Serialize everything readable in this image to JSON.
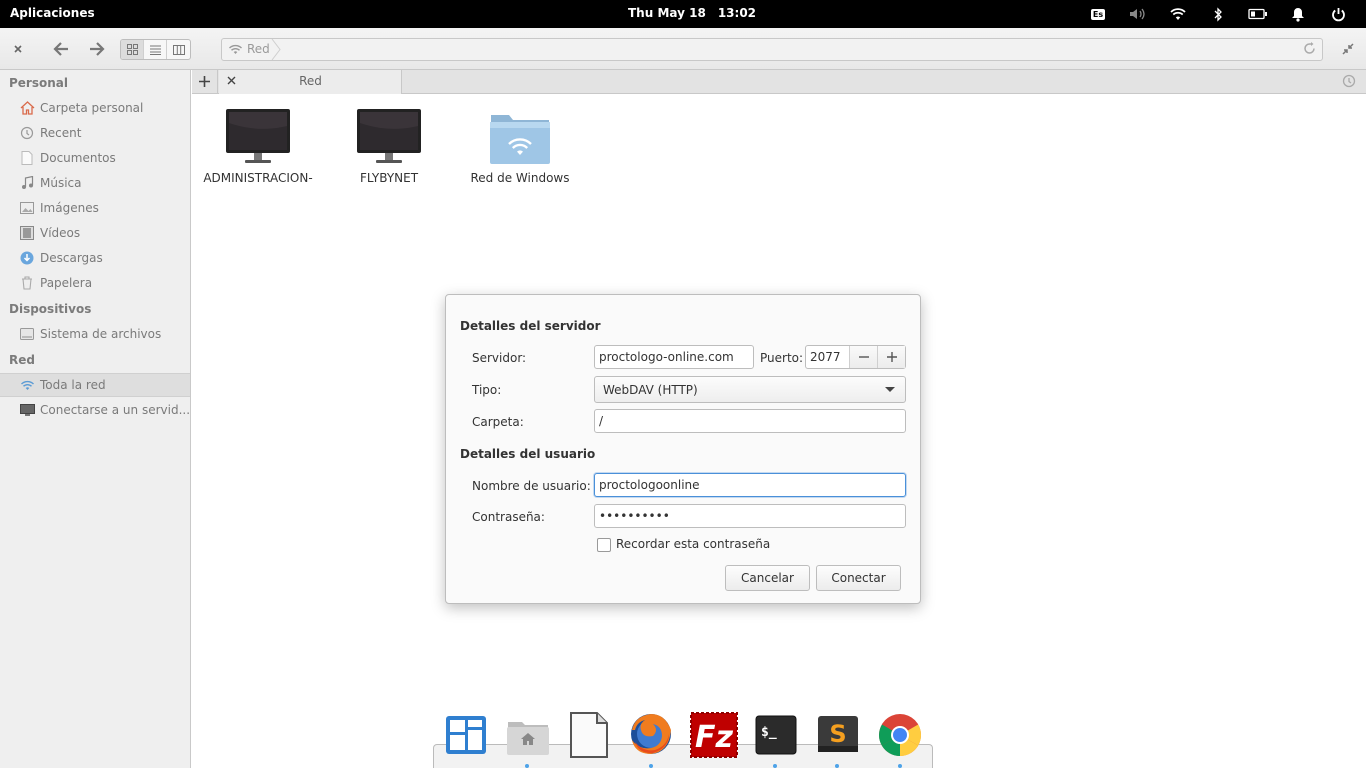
{
  "top_panel": {
    "apps_label": "Aplicaciones",
    "day_date": "Thu May 18",
    "time": "13:02",
    "keyboard_layout": "Es"
  },
  "headerbar": {
    "location": "Red"
  },
  "sidebar": {
    "sections": [
      {
        "heading": "Personal",
        "items": [
          {
            "label": "Carpeta personal",
            "icon": "home-icon"
          },
          {
            "label": "Recent",
            "icon": "recent-icon"
          },
          {
            "label": "Documentos",
            "icon": "document-icon"
          },
          {
            "label": "Música",
            "icon": "music-icon"
          },
          {
            "label": "Imágenes",
            "icon": "pictures-icon"
          },
          {
            "label": "Vídeos",
            "icon": "videos-icon"
          },
          {
            "label": "Descargas",
            "icon": "downloads-icon"
          },
          {
            "label": "Papelera",
            "icon": "trash-icon"
          }
        ]
      },
      {
        "heading": "Dispositivos",
        "items": [
          {
            "label": "Sistema de archivos",
            "icon": "drive-icon"
          }
        ]
      },
      {
        "heading": "Red",
        "items": [
          {
            "label": "Toda la red",
            "icon": "network-icon"
          },
          {
            "label": "Conectarse a un servid...",
            "icon": "server-icon"
          }
        ]
      }
    ]
  },
  "tab": {
    "label": "Red"
  },
  "files": [
    {
      "label": "ADMINISTRACION-",
      "icon": "monitor-icon"
    },
    {
      "label": "FLYBYNET",
      "icon": "monitor-icon"
    },
    {
      "label": "Red de Windows",
      "icon": "network-folder-icon"
    }
  ],
  "dialog": {
    "server_heading": "Detalles del servidor",
    "server_label": "Servidor:",
    "server_value": "proctologo-online.com",
    "port_label": "Puerto:",
    "port_value": "2077",
    "type_label": "Tipo:",
    "type_value": "WebDAV (HTTP)",
    "folder_label": "Carpeta:",
    "folder_value": "/",
    "user_heading": "Detalles del usuario",
    "username_label": "Nombre de usuario:",
    "username_value": "proctologoonline",
    "password_label": "Contraseña:",
    "password_value": "••••••••••",
    "remember_label": "Recordar esta contraseña",
    "remember_checked": false,
    "cancel_label": "Cancelar",
    "connect_label": "Conectar"
  },
  "dock": {
    "items": [
      "multitasking-view-icon",
      "files-icon",
      "text-editor-icon",
      "firefox-icon",
      "filezilla-icon",
      "terminal-icon",
      "sublime-text-icon",
      "chrome-icon"
    ],
    "terminal_glyph": "$_",
    "filezilla_glyph": "Fz",
    "sublime_glyph": "S"
  }
}
